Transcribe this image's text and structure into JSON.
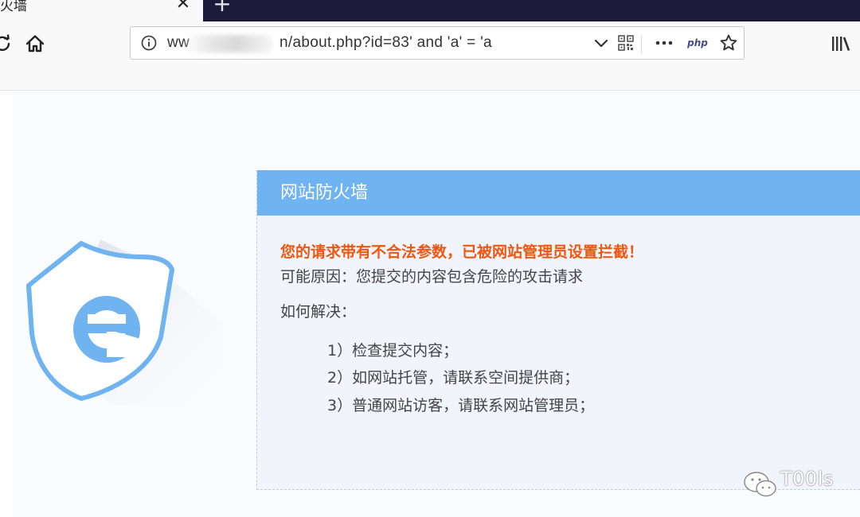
{
  "browser": {
    "tab": {
      "title": "火墙",
      "close_glyph": "✕"
    },
    "new_tab_glyph": "+",
    "urlbar": {
      "prefix": "ww",
      "suffix": "n/about.php?id=83' and 'a' = 'a"
    },
    "icons": {
      "reload": "reload-icon",
      "home": "home-icon",
      "info": "info-icon",
      "dropdown": "chevron-down-icon",
      "qr": "qr-code-icon",
      "more": "more-icon",
      "php": "php",
      "star": "star-icon",
      "library": "library-icon"
    }
  },
  "firewall": {
    "title": "网站防火墙",
    "warning": "您的请求带有不合法参数，已被网站管理员设置拦截！",
    "reason": "可能原因：您提交的内容包含危险的攻击请求",
    "howto": "如何解决：",
    "steps": [
      "1）检查提交内容；",
      "2）如网站托管，请联系空间提供商；",
      "3）普通网站访客，请联系网站管理员；"
    ],
    "colors": {
      "header": "#6fb3f0",
      "warning": "#f0560f",
      "shield": "#6fb3f0"
    }
  },
  "watermark": {
    "text": "T00ls"
  }
}
